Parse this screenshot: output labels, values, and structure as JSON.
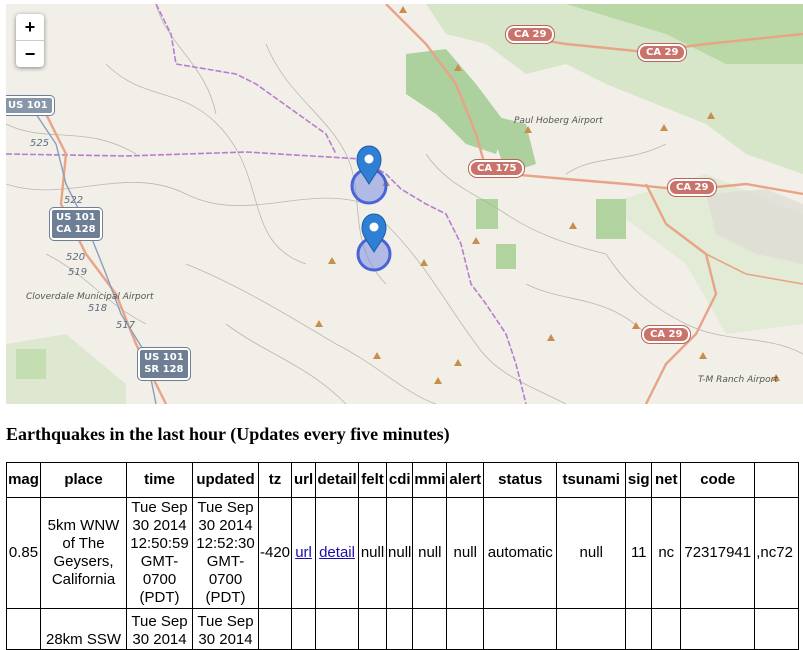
{
  "map": {
    "zoom_in": "+",
    "zoom_out": "−",
    "shields": [
      {
        "kind": "ca",
        "text": "CA 29"
      },
      {
        "kind": "ca",
        "text": "CA 29"
      },
      {
        "kind": "ca",
        "text": "CA 175"
      },
      {
        "kind": "ca",
        "text": "CA 29"
      },
      {
        "kind": "ca",
        "text": "CA 29"
      },
      {
        "kind": "us",
        "text": "US 101"
      },
      {
        "kind": "us",
        "text": "US 101"
      },
      {
        "kind": "us",
        "text": "CA 128"
      },
      {
        "kind": "us",
        "text": "US 101"
      },
      {
        "kind": "us",
        "text": "SR 128"
      }
    ],
    "labels": {
      "airport1": "Paul Hoberg Airport",
      "airport2": "Cloverdale Municipal Airport",
      "airport3": "T-M Ranch Airport"
    },
    "route_numbers": [
      "525",
      "522",
      "520",
      "519",
      "518",
      "517"
    ],
    "colors": {
      "land": "#f2efe9",
      "forest": "#add19e",
      "park": "#c8e0b4",
      "county_line": "#b57ed0",
      "highway": "#e89b8a",
      "marker": "#2f7fd4"
    }
  },
  "heading": "Earthquakes in the last hour (Updates every five minutes)",
  "table": {
    "headers": [
      "mag",
      "place",
      "time",
      "updated",
      "tz",
      "url",
      "detail",
      "felt",
      "cdi",
      "mmi",
      "alert",
      "status",
      "tsunami",
      "sig",
      "net",
      "code"
    ],
    "row1": {
      "mag": "0.85",
      "place": "5km WNW of The Geysers, California",
      "time": "Tue Sep 30 2014 12:50:59 GMT-0700 (PDT)",
      "updated": "Tue Sep 30 2014 12:52:30 GMT-0700 (PDT)",
      "tz": "-420",
      "url": "url",
      "detail": "detail",
      "felt": "null",
      "cdi": "null",
      "mmi": "null",
      "alert": "null",
      "status": "automatic",
      "tsunami": "null",
      "sig": "11",
      "net": "nc",
      "code": "72317941",
      "ids": ",nc72"
    },
    "row2": {
      "place": "28km SSW",
      "time": "Tue Sep 30 2014",
      "updated": "Tue Sep 30 2014"
    }
  }
}
